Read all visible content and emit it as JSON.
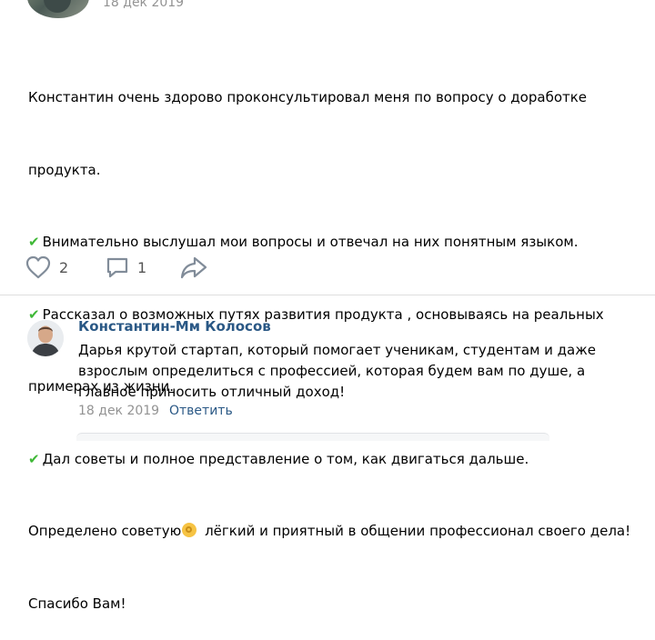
{
  "post": {
    "date": "18 дек 2019",
    "lines": [
      "Константин очень здорово проконсультировал меня по вопросу о доработке",
      "продукта.",
      "Внимательно выслушал мои вопросы и отвечал на них понятным языком.",
      "Рассказал о возможных путях развития продукта , основываясь на реальных",
      "примерах из жизни.",
      "Дал советы и полное представление о том, как двигаться дальше.",
      "Определено советую",
      "лёгкий и приятный в общении профессионал своего дела!",
      "Спасибо Вам!"
    ],
    "likes": "2",
    "comments": "1"
  },
  "comment": {
    "author": "Константин-Мм Колосов",
    "lines": [
      "Дарья крутой стартап, который помогает ученикам, студентам и даже",
      "взрослым определиться с профессией, которая будем вам по душе, а",
      "главное приносить отличный доход!"
    ],
    "date": "18 дек 2019",
    "reply_label": "Ответить"
  },
  "colors": {
    "link": "#2a5885",
    "meta": "#939393",
    "check": "#3fb837",
    "icon": "#818c99"
  },
  "icons": [
    "heart-icon",
    "comment-icon",
    "share-icon",
    "check-icon",
    "ok-hand-emoji"
  ]
}
